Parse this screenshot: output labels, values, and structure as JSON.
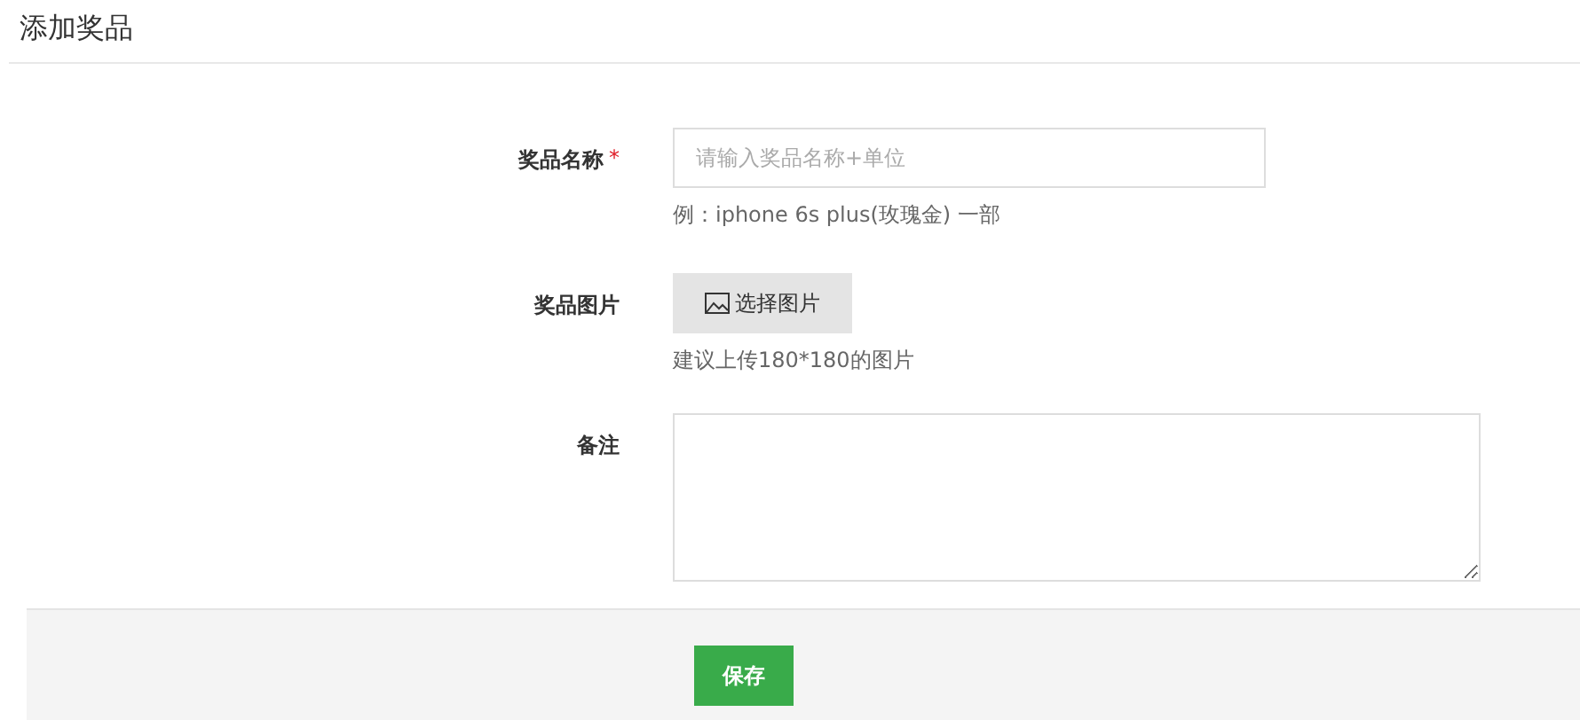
{
  "page": {
    "title": "添加奖品"
  },
  "form": {
    "fields": [
      {
        "kind": "text",
        "label": "奖品名称",
        "required": true,
        "required_mark": "*",
        "placeholder": "请输入奖品名称+单位",
        "help": "例：iphone 6s plus(玫瑰金) 一部"
      },
      {
        "kind": "image",
        "label": "奖品图片",
        "required": false,
        "button": "选择图片",
        "help": "建议上传180*180的图片"
      },
      {
        "kind": "textarea",
        "label": "备注",
        "required": false
      }
    ]
  },
  "footer": {
    "buttons": [
      "保存"
    ]
  }
}
